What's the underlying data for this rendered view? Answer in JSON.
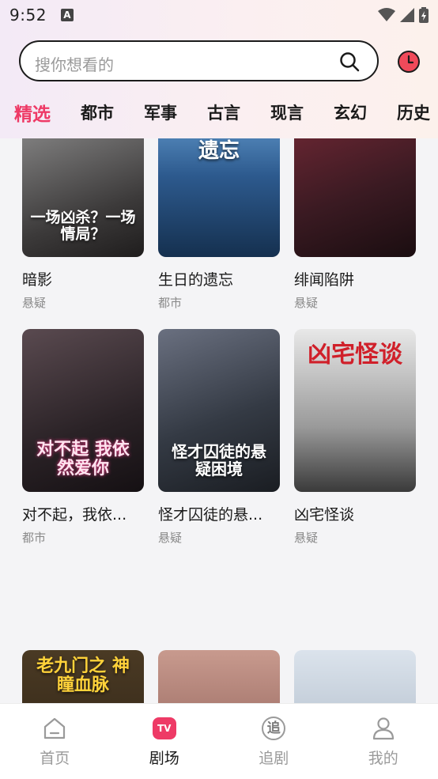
{
  "status_bar": {
    "time": "9:52",
    "notification": "A"
  },
  "search": {
    "placeholder": "搜你想看的"
  },
  "tabs": [
    {
      "label": "精选",
      "active": true
    },
    {
      "label": "都市"
    },
    {
      "label": "军事"
    },
    {
      "label": "古言"
    },
    {
      "label": "现言"
    },
    {
      "label": "玄幻"
    },
    {
      "label": "历史"
    }
  ],
  "dramas": [
    {
      "title": "暗影",
      "genre": "悬疑",
      "poster_text": "一场凶杀？一场情局？",
      "poster_color": "#3c3a3a"
    },
    {
      "title": "生日的遗忘",
      "genre": "都市",
      "poster_text": "遗忘",
      "poster_color": "#1f3f6a"
    },
    {
      "title": "绯闻陷阱",
      "genre": "悬疑",
      "poster_text": "",
      "poster_color": "#5a2330"
    },
    {
      "title": "对不起，我依...",
      "genre": "都市",
      "poster_text": "对不起 我依然爱你",
      "poster_color": "#3a3236"
    },
    {
      "title": "怪才囚徒的悬...",
      "genre": "悬疑",
      "poster_text": "怪才囚徒的悬疑困境",
      "poster_color": "#343a44"
    },
    {
      "title": "凶宅怪谈",
      "genre": "悬疑",
      "poster_text": "凶宅怪谈",
      "poster_color": "#e2e2e2"
    },
    {
      "title": "",
      "genre": "",
      "poster_text": "老九门之 神瞳血脉",
      "poster_color": "#3a2c1c"
    },
    {
      "title": "",
      "genre": "",
      "poster_text": "",
      "poster_color": "#a2706a"
    },
    {
      "title": "",
      "genre": "",
      "poster_text": "",
      "poster_color": "#c9d3de"
    }
  ],
  "bottom_nav": [
    {
      "label": "首页",
      "icon": "home-icon"
    },
    {
      "label": "剧场",
      "icon": "tv-icon",
      "active": true,
      "badge": "TV"
    },
    {
      "label": "追剧",
      "icon": "follow-icon",
      "badge": "追"
    },
    {
      "label": "我的",
      "icon": "profile-icon"
    }
  ],
  "colors": {
    "accent": "#ee3a66",
    "history": "#f04a5a"
  }
}
